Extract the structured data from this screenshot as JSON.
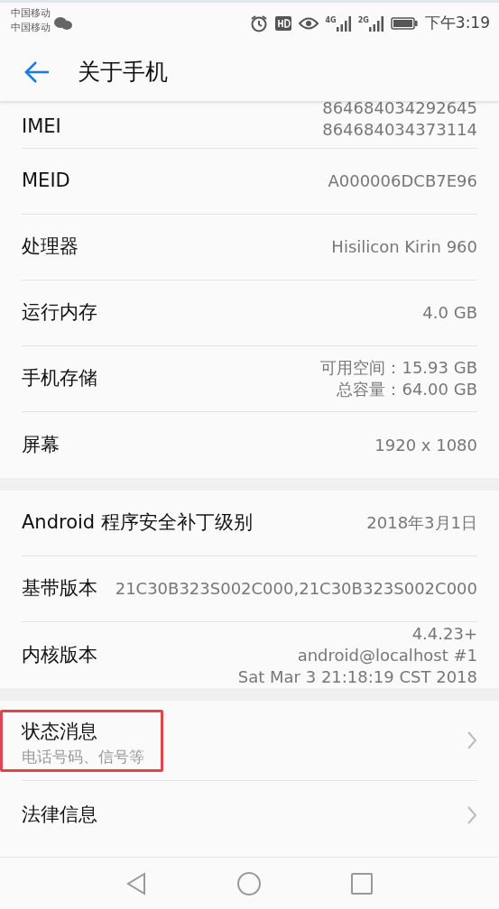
{
  "status_bar": {
    "carriers": [
      "中国移动",
      "中国移动"
    ],
    "time": "下午3:19",
    "network_labels": [
      "4G",
      "2G"
    ]
  },
  "header": {
    "title": "关于手机"
  },
  "sections": [
    {
      "items": [
        {
          "kind": "info",
          "label": "IMEI",
          "values": [
            "864684034292645",
            "864684034373114"
          ]
        },
        {
          "kind": "info",
          "label": "MEID",
          "values": [
            "A000006DCB7E96"
          ]
        },
        {
          "kind": "info",
          "label": "处理器",
          "values": [
            "Hisilicon Kirin 960"
          ]
        },
        {
          "kind": "info",
          "label": "运行内存",
          "values": [
            "4.0 GB"
          ]
        },
        {
          "kind": "info",
          "label": "手机存储",
          "values": [
            "可用空间：15.93  GB",
            "总容量：64.00  GB"
          ]
        },
        {
          "kind": "info",
          "label": "屏幕",
          "values": [
            "1920 x 1080"
          ]
        }
      ]
    },
    {
      "items": [
        {
          "kind": "info",
          "label": "Android 程序安全补丁级别",
          "values": [
            "2018年3月1日"
          ]
        },
        {
          "kind": "info",
          "label": "基带版本",
          "values": [
            "21C30B323S002C000,21C30B323S002C000"
          ]
        },
        {
          "kind": "info",
          "label": "内核版本",
          "values": [
            "4.4.23+",
            "android@localhost #1",
            "Sat Mar 3 21:18:19 CST 2018"
          ]
        }
      ]
    },
    {
      "items": [
        {
          "kind": "link",
          "label": "状态消息",
          "subtitle": "电话号码、信号等",
          "highlighted": true
        },
        {
          "kind": "link",
          "label": "法律信息",
          "highlighted": false
        }
      ]
    }
  ]
}
